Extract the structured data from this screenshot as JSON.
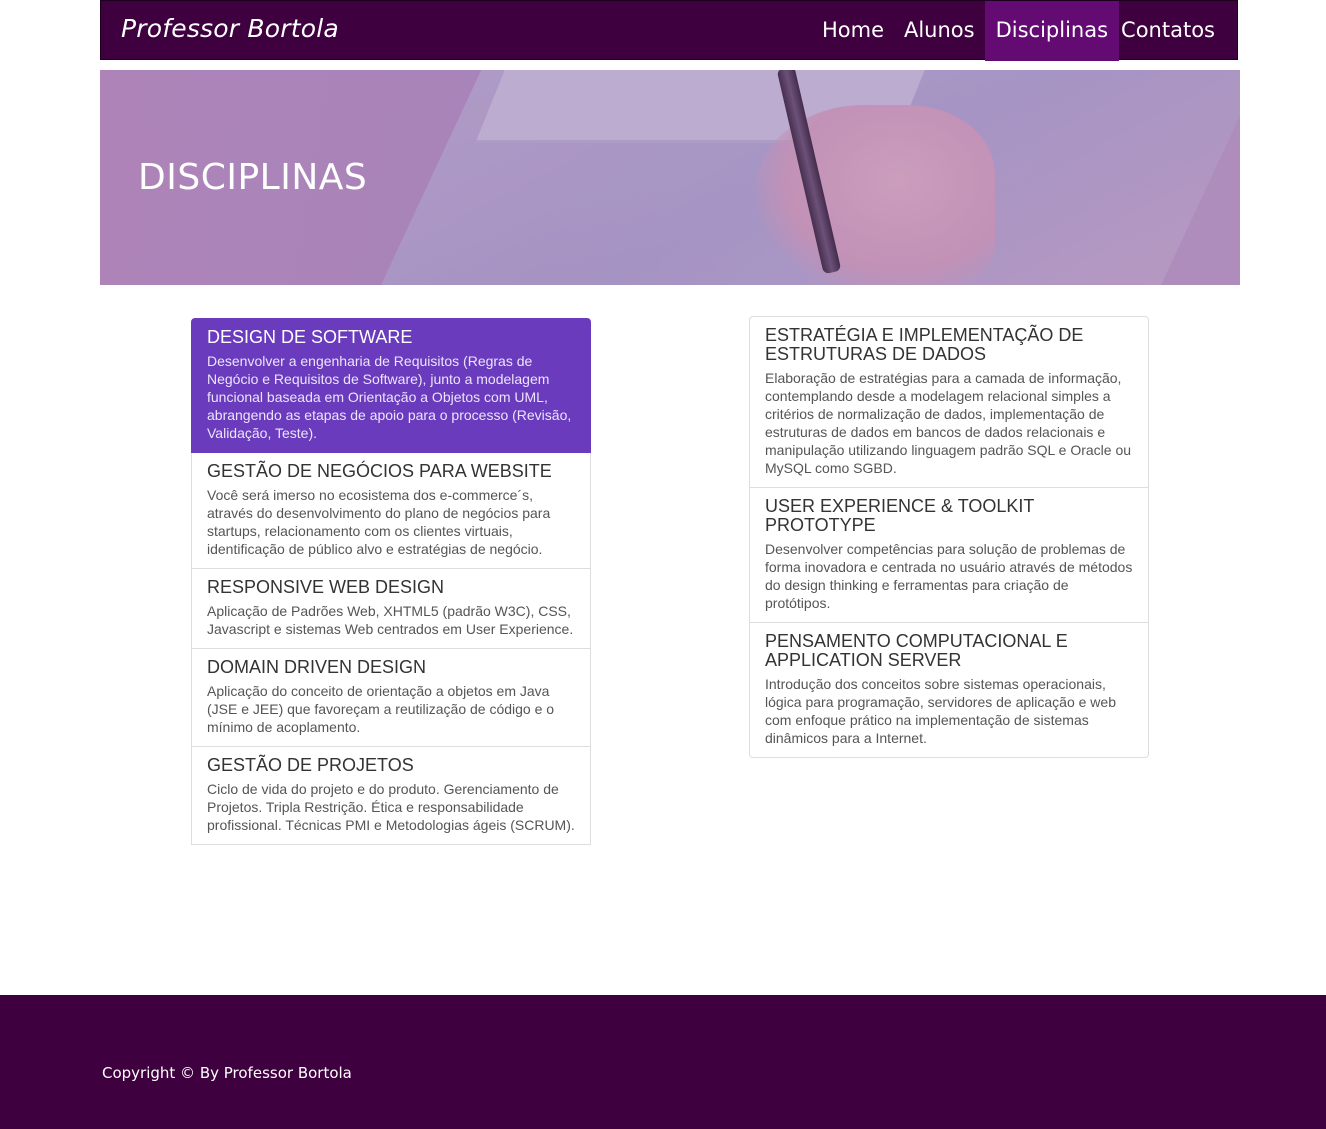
{
  "navbar": {
    "brand": "Professor Bortola",
    "links": [
      {
        "label": "Home",
        "active": false
      },
      {
        "label": "Alunos",
        "active": false
      },
      {
        "label": "Disciplinas",
        "active": true
      },
      {
        "label": "Contatos",
        "active": false
      }
    ]
  },
  "hero": {
    "title": "DISCIPLINAS"
  },
  "courses_left": [
    {
      "title": "DESIGN DE SOFTWARE",
      "description": "Desenvolver a engenharia de Requisitos (Regras de Negócio e Requisitos de Software), junto a modelagem funcional baseada em Orientação a Objetos com UML, abrangendo as etapas de apoio para o processo (Revisão, Validação, Teste).",
      "active": true
    },
    {
      "title": "GESTÃO DE NEGÓCIOS PARA WEBSITE",
      "description": "Você será imerso no ecosistema dos e-commerce´s, através do desenvolvimento do plano de negócios para startups, relacionamento com os clientes virtuais, identificação de público alvo e estratégias de negócio.",
      "active": false
    },
    {
      "title": "RESPONSIVE WEB DESIGN",
      "description": "Aplicação de Padrões Web, XHTML5 (padrão W3C), CSS, Javascript e sistemas Web centrados em User Experience.",
      "active": false
    },
    {
      "title": "DOMAIN DRIVEN DESIGN",
      "description": "Aplicação do conceito de orientação a objetos em Java (JSE e JEE) que favoreçam a reutilização de código e o mínimo de acoplamento.",
      "active": false
    },
    {
      "title": "GESTÃO DE PROJETOS",
      "description": "Ciclo de vida do projeto e do produto. Gerenciamento de Projetos. Tripla Restrição. Ética e responsabilidade profissional. Técnicas PMI e Metodologias ágeis (SCRUM).",
      "active": false
    }
  ],
  "courses_right": [
    {
      "title": "ESTRATÉGIA E IMPLEMENTAÇÃO DE ESTRUTURAS DE DADOS",
      "description": "Elaboração de estratégias para a camada de informação, contemplando desde a modelagem relacional simples a critérios de normalização de dados, implementação de estruturas de dados em bancos de dados relacionais e manipulação utilizando linguagem padrão SQL e Oracle ou MySQL como SGBD.",
      "active": false
    },
    {
      "title": "USER EXPERIENCE & TOOLKIT PROTOTYPE",
      "description": "Desenvolver competências para solução de problemas de forma inovadora e centrada no usuário através de métodos do design thinking e ferramentas para criação de protótipos.",
      "active": false
    },
    {
      "title": "PENSAMENTO COMPUTACIONAL E APPLICATION SERVER",
      "description": "Introdução dos conceitos sobre sistemas operacionais, lógica para programação, servidores de aplicação e web com enfoque prático na implementação de sistemas dinâmicos para a Internet.",
      "active": false
    }
  ],
  "footer": {
    "copyright": "Copyright © By Professor Bortola"
  },
  "colors": {
    "primary": "#3f0040",
    "nav_active": "#640a73",
    "list_active": "#6a3bbd"
  }
}
